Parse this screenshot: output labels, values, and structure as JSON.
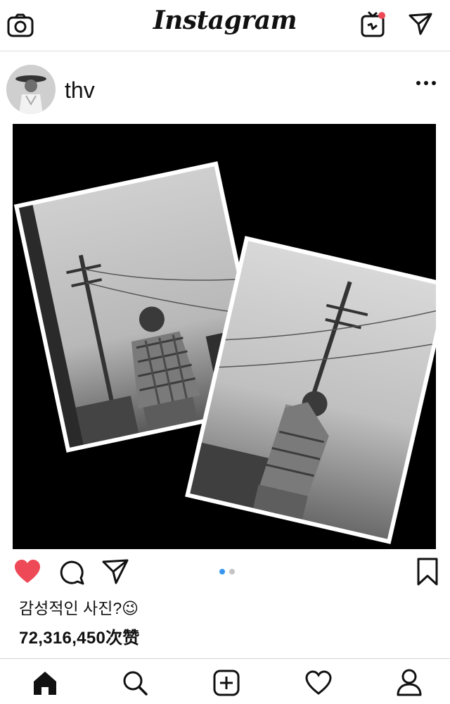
{
  "header": {
    "logo": "Instagram",
    "icons": [
      "camera-icon",
      "igtv-icon",
      "direct-message-icon"
    ],
    "notification_color": "#ed4956"
  },
  "post": {
    "username": "thv",
    "caption": "감성적인 사진?😉",
    "likes": "72,316,450次赞",
    "carousel": {
      "current": 1,
      "total": 2
    },
    "liked": true,
    "heart_color": "#ed4956"
  },
  "actions": {
    "icons": [
      "like-heart-icon",
      "comment-icon",
      "share-icon",
      "bookmark-icon"
    ]
  },
  "bottom_nav": {
    "items": [
      "home-icon",
      "search-icon",
      "new-post-icon",
      "activity-icon",
      "profile-icon"
    ]
  },
  "colors": {
    "accent_dot": "#3897f0"
  }
}
